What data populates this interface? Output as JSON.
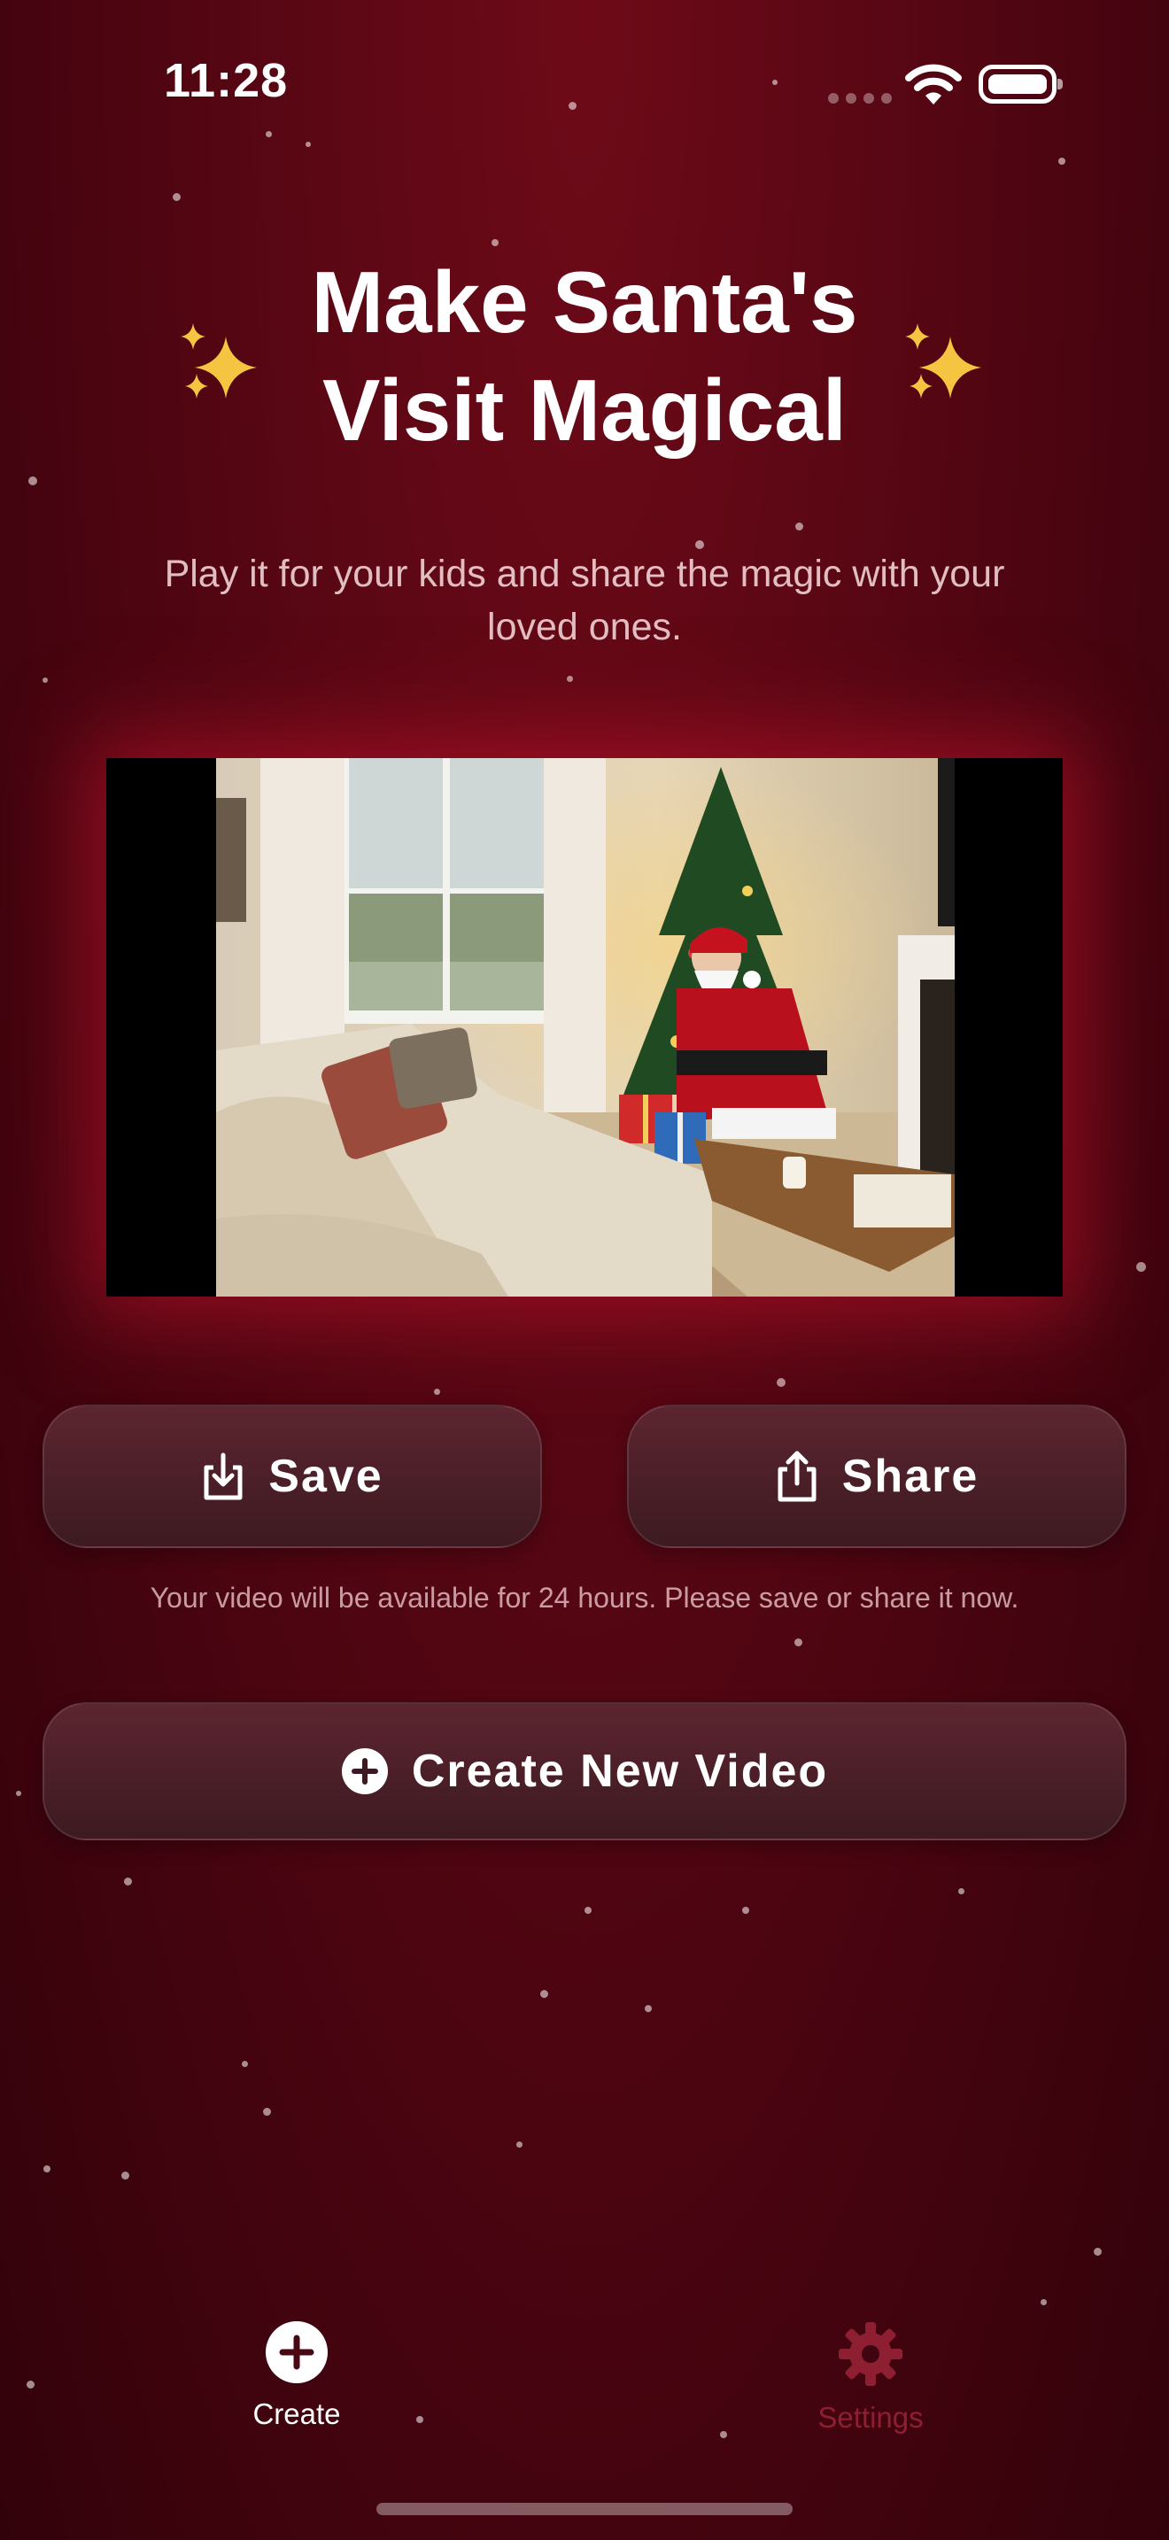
{
  "status_bar": {
    "time": "11:28"
  },
  "header": {
    "title": "Make Santa's Visit Magical",
    "subtitle": "Play it for your kids and share the magic with your loved ones."
  },
  "video": {
    "description_icon": "santa-video-thumbnail"
  },
  "actions": {
    "save_label": "Save",
    "share_label": "Share",
    "note": "Your video will be available for 24 hours. Please save or share it now.",
    "create_label": "Create New Video"
  },
  "tab_bar": {
    "items": [
      {
        "label": "Create",
        "icon": "plus-circle-icon",
        "active": true
      },
      {
        "label": "Settings",
        "icon": "gear-icon",
        "active": false
      }
    ]
  },
  "colors": {
    "background": "#5a0714",
    "accent_inactive": "#8e1e31",
    "button": "#4a1f27",
    "sparkle": "#f5c542"
  }
}
